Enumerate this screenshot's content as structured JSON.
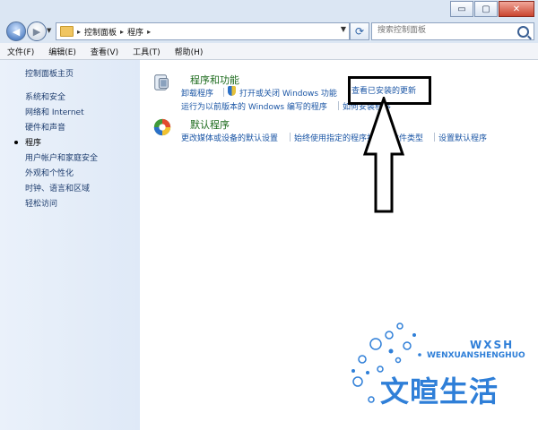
{
  "titlebar": {
    "buttons": {
      "minimize": "▭",
      "maximize": "▢",
      "close": "✕"
    }
  },
  "nav": {
    "back_icon": "arrow-left",
    "forward_icon": "arrow-right",
    "breadcrumb": [
      "控制面板",
      "程序"
    ],
    "search": {
      "placeholder": "搜索控制面板"
    }
  },
  "menu": [
    "文件(F)",
    "编辑(E)",
    "查看(V)",
    "工具(T)",
    "帮助(H)"
  ],
  "sidebar": {
    "home": "控制面板主页",
    "items": [
      "系统和安全",
      "网络和 Internet",
      "硬件和声音",
      "程序",
      "用户帐户和家庭安全",
      "外观和个性化",
      "时钟、语言和区域",
      "轻松访问"
    ],
    "active": "程序"
  },
  "main": {
    "programs": {
      "title": "程序和功能",
      "links_row1": [
        "卸载程序",
        "打开或关闭 Windows 功能",
        "查看已安装的更新"
      ],
      "links_row2": [
        "运行为以前版本的 Windows 编写的程序",
        "如何安装程序"
      ]
    },
    "defaults": {
      "title": "默认程序",
      "links": [
        "更改媒体或设备的默认设置",
        "始终使用指定的程序打开此文件类型",
        "设置默认程序"
      ]
    }
  },
  "annotation": {
    "highlight_text": "查看已安装的更新"
  },
  "watermark": {
    "small": "WXSH",
    "latin": "WENXUANSHENGHUO",
    "chinese": "文暄生活"
  },
  "colors": {
    "title_green": "#1d6b1d",
    "link_blue": "#1b56a5",
    "sidebar_bg": "#eaf1fa",
    "watermark_blue": "#2f7fd8"
  }
}
